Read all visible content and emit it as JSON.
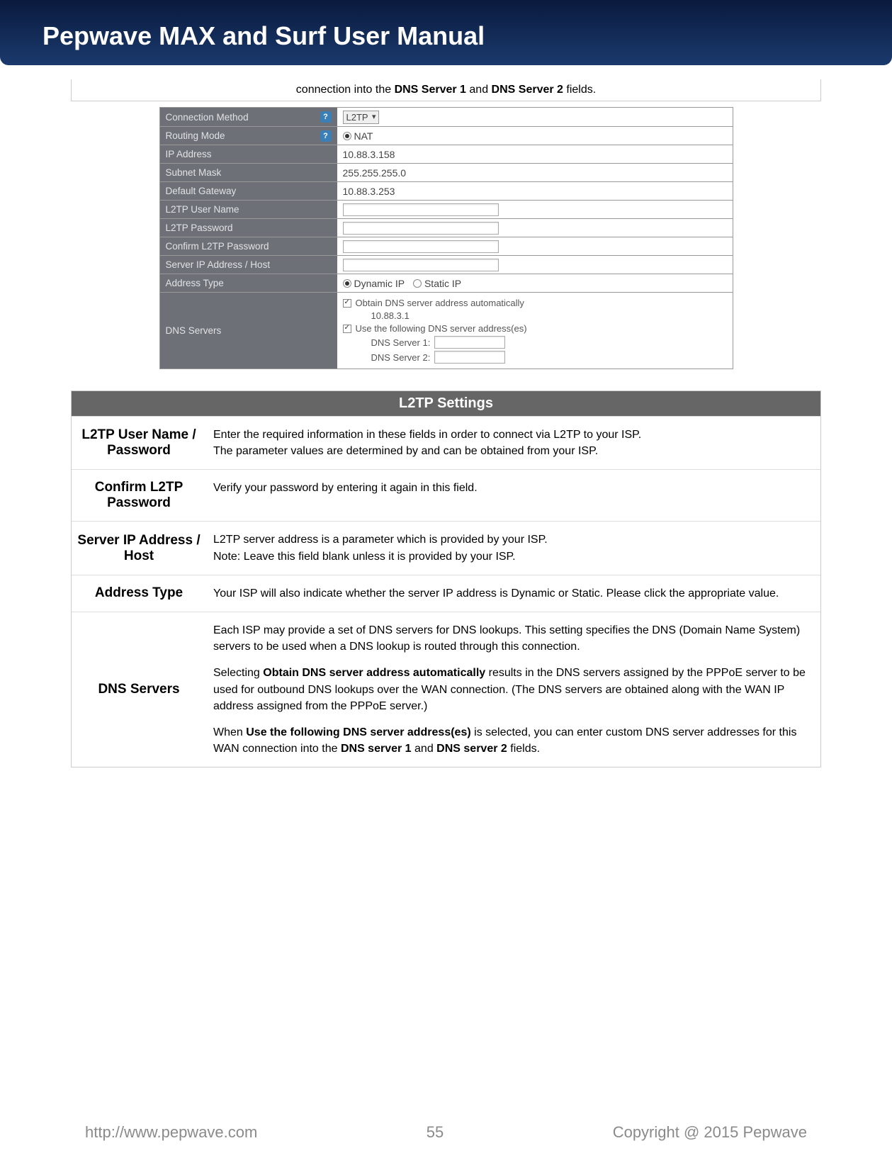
{
  "header": {
    "title": "Pepwave MAX and Surf User Manual"
  },
  "top_note": {
    "prefix": "connection into the ",
    "b1": "DNS Server 1",
    "mid": " and ",
    "b2": "DNS Server 2",
    "suffix": " fields."
  },
  "config": {
    "rows": [
      {
        "label": "Connection Method",
        "help": true,
        "type": "select",
        "value": "L2TP"
      },
      {
        "label": "Routing Mode",
        "help": true,
        "type": "radio",
        "value": "NAT"
      },
      {
        "label": "IP Address",
        "type": "text",
        "value": "10.88.3.158"
      },
      {
        "label": "Subnet Mask",
        "type": "text",
        "value": "255.255.255.0"
      },
      {
        "label": "Default Gateway",
        "type": "text",
        "value": "10.88.3.253"
      },
      {
        "label": "L2TP User Name",
        "type": "input"
      },
      {
        "label": "L2TP Password",
        "type": "input"
      },
      {
        "label": "Confirm L2TP Password",
        "type": "input"
      },
      {
        "label": "Server IP Address / Host",
        "type": "input"
      },
      {
        "label": "Address Type",
        "type": "radios",
        "opt1": "Dynamic IP",
        "opt2": "Static IP"
      }
    ],
    "dns": {
      "label": "DNS Servers",
      "auto": "Obtain DNS server address automatically",
      "auto_val": "10.88.3.1",
      "custom": "Use the following DNS server address(es)",
      "s1": "DNS Server 1:",
      "s2": "DNS Server 2:"
    }
  },
  "settings": {
    "title": "L2TP Settings",
    "rows": [
      {
        "label": "L2TP User Name / Password",
        "desc_a": "Enter the required information in these fields in order to connect via L2TP to your ISP.",
        "desc_b": "The parameter values are determined by and can be obtained from your ISP."
      },
      {
        "label": "Confirm L2TP Password",
        "desc_a": "Verify your password by entering it again in this field."
      },
      {
        "label": "Server IP Address / Host",
        "desc_a": "L2TP server address is a parameter which is provided by your ISP.",
        "desc_b": "Note: Leave this field blank unless it is provided by your ISP."
      },
      {
        "label": "Address Type",
        "desc_a": "Your ISP will also indicate whether the server IP address is Dynamic or Static. Please click the appropriate value."
      }
    ],
    "dns_row": {
      "label": "DNS Servers",
      "p1": "Each ISP may provide a set of DNS servers for DNS lookups. This setting specifies the DNS (Domain Name System) servers to be used when a DNS lookup is routed through this connection.",
      "p2a": "Selecting ",
      "p2b": "Obtain DNS server address automatically",
      "p2c": " results in the DNS servers assigned by the PPPoE server to be used for outbound DNS lookups over the WAN connection. (The DNS servers are obtained along with the WAN IP address assigned from the PPPoE server.)",
      "p3a": "When ",
      "p3b": "Use the following DNS server address(es)",
      "p3c": " is selected, you can enter custom DNS server addresses for this WAN connection into the ",
      "p3d": "DNS server 1",
      "p3e": " and ",
      "p3f": "DNS server 2",
      "p3g": " fields."
    }
  },
  "footer": {
    "url": "http://www.pepwave.com",
    "page": "55",
    "copy": "Copyright @ 2015 Pepwave"
  }
}
